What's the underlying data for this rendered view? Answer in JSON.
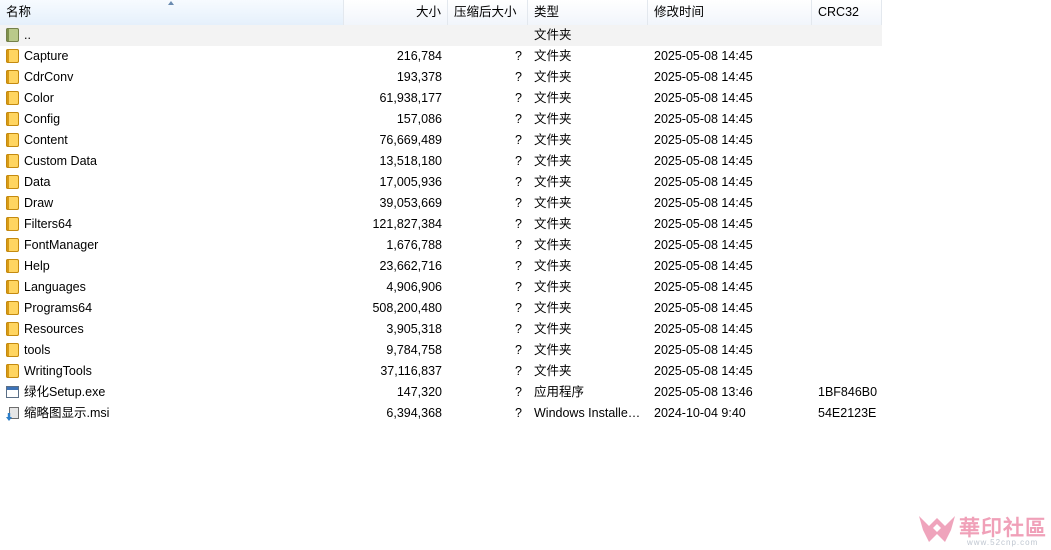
{
  "header": {
    "name": "名称",
    "size": "大小",
    "packed": "压缩后大小",
    "type": "类型",
    "modified": "修改时间",
    "crc": "CRC32"
  },
  "rows": [
    {
      "name": "..",
      "size": "",
      "packed": "",
      "type": "文件夹",
      "modified": "",
      "crc": "",
      "icon": "folder-up-icon"
    },
    {
      "name": "Capture",
      "size": "216,784",
      "packed": "?",
      "type": "文件夹",
      "modified": "2025-05-08 14:45",
      "crc": "",
      "icon": "folder-icon"
    },
    {
      "name": "CdrConv",
      "size": "193,378",
      "packed": "?",
      "type": "文件夹",
      "modified": "2025-05-08 14:45",
      "crc": "",
      "icon": "folder-icon"
    },
    {
      "name": "Color",
      "size": "61,938,177",
      "packed": "?",
      "type": "文件夹",
      "modified": "2025-05-08 14:45",
      "crc": "",
      "icon": "folder-icon"
    },
    {
      "name": "Config",
      "size": "157,086",
      "packed": "?",
      "type": "文件夹",
      "modified": "2025-05-08 14:45",
      "crc": "",
      "icon": "folder-icon"
    },
    {
      "name": "Content",
      "size": "76,669,489",
      "packed": "?",
      "type": "文件夹",
      "modified": "2025-05-08 14:45",
      "crc": "",
      "icon": "folder-icon"
    },
    {
      "name": "Custom Data",
      "size": "13,518,180",
      "packed": "?",
      "type": "文件夹",
      "modified": "2025-05-08 14:45",
      "crc": "",
      "icon": "folder-icon"
    },
    {
      "name": "Data",
      "size": "17,005,936",
      "packed": "?",
      "type": "文件夹",
      "modified": "2025-05-08 14:45",
      "crc": "",
      "icon": "folder-icon"
    },
    {
      "name": "Draw",
      "size": "39,053,669",
      "packed": "?",
      "type": "文件夹",
      "modified": "2025-05-08 14:45",
      "crc": "",
      "icon": "folder-icon"
    },
    {
      "name": "Filters64",
      "size": "121,827,384",
      "packed": "?",
      "type": "文件夹",
      "modified": "2025-05-08 14:45",
      "crc": "",
      "icon": "folder-icon"
    },
    {
      "name": "FontManager",
      "size": "1,676,788",
      "packed": "?",
      "type": "文件夹",
      "modified": "2025-05-08 14:45",
      "crc": "",
      "icon": "folder-icon"
    },
    {
      "name": "Help",
      "size": "23,662,716",
      "packed": "?",
      "type": "文件夹",
      "modified": "2025-05-08 14:45",
      "crc": "",
      "icon": "folder-icon"
    },
    {
      "name": "Languages",
      "size": "4,906,906",
      "packed": "?",
      "type": "文件夹",
      "modified": "2025-05-08 14:45",
      "crc": "",
      "icon": "folder-icon"
    },
    {
      "name": "Programs64",
      "size": "508,200,480",
      "packed": "?",
      "type": "文件夹",
      "modified": "2025-05-08 14:45",
      "crc": "",
      "icon": "folder-icon"
    },
    {
      "name": "Resources",
      "size": "3,905,318",
      "packed": "?",
      "type": "文件夹",
      "modified": "2025-05-08 14:45",
      "crc": "",
      "icon": "folder-icon"
    },
    {
      "name": "tools",
      "size": "9,784,758",
      "packed": "?",
      "type": "文件夹",
      "modified": "2025-05-08 14:45",
      "crc": "",
      "icon": "folder-icon"
    },
    {
      "name": "WritingTools",
      "size": "37,116,837",
      "packed": "?",
      "type": "文件夹",
      "modified": "2025-05-08 14:45",
      "crc": "",
      "icon": "folder-icon"
    },
    {
      "name": "绿化Setup.exe",
      "size": "147,320",
      "packed": "?",
      "type": "应用程序",
      "modified": "2025-05-08 13:46",
      "crc": "1BF846B0",
      "icon": "exe-icon"
    },
    {
      "name": "缩略图显示.msi",
      "size": "6,394,368",
      "packed": "?",
      "type": "Windows Installer ...",
      "modified": "2024-10-04 9:40",
      "crc": "54E2123E",
      "icon": "msi-icon"
    }
  ],
  "watermark": {
    "text": "華印社區",
    "url": "www.52cnp.com"
  }
}
